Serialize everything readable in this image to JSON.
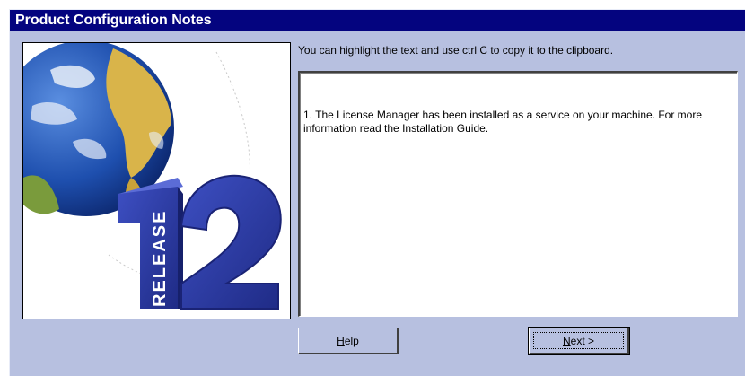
{
  "window": {
    "title": "Product Configuration Notes"
  },
  "branding": {
    "vertical_text": "RELEASE",
    "number": "12"
  },
  "instruction": "You can highlight the text and use ctrl C to copy it to the clipboard.",
  "notes": {
    "text": "1. The License Manager has been installed as a service on your machine.  For more information read the Installation Guide."
  },
  "buttons": {
    "help_mnemonic": "H",
    "help_rest": "elp",
    "next_mnemonic": "N",
    "next_rest": "ext >"
  },
  "colors": {
    "titlebar": "#04047f",
    "background": "#b7c0e0",
    "logo_blue": "#2d3a9e"
  }
}
